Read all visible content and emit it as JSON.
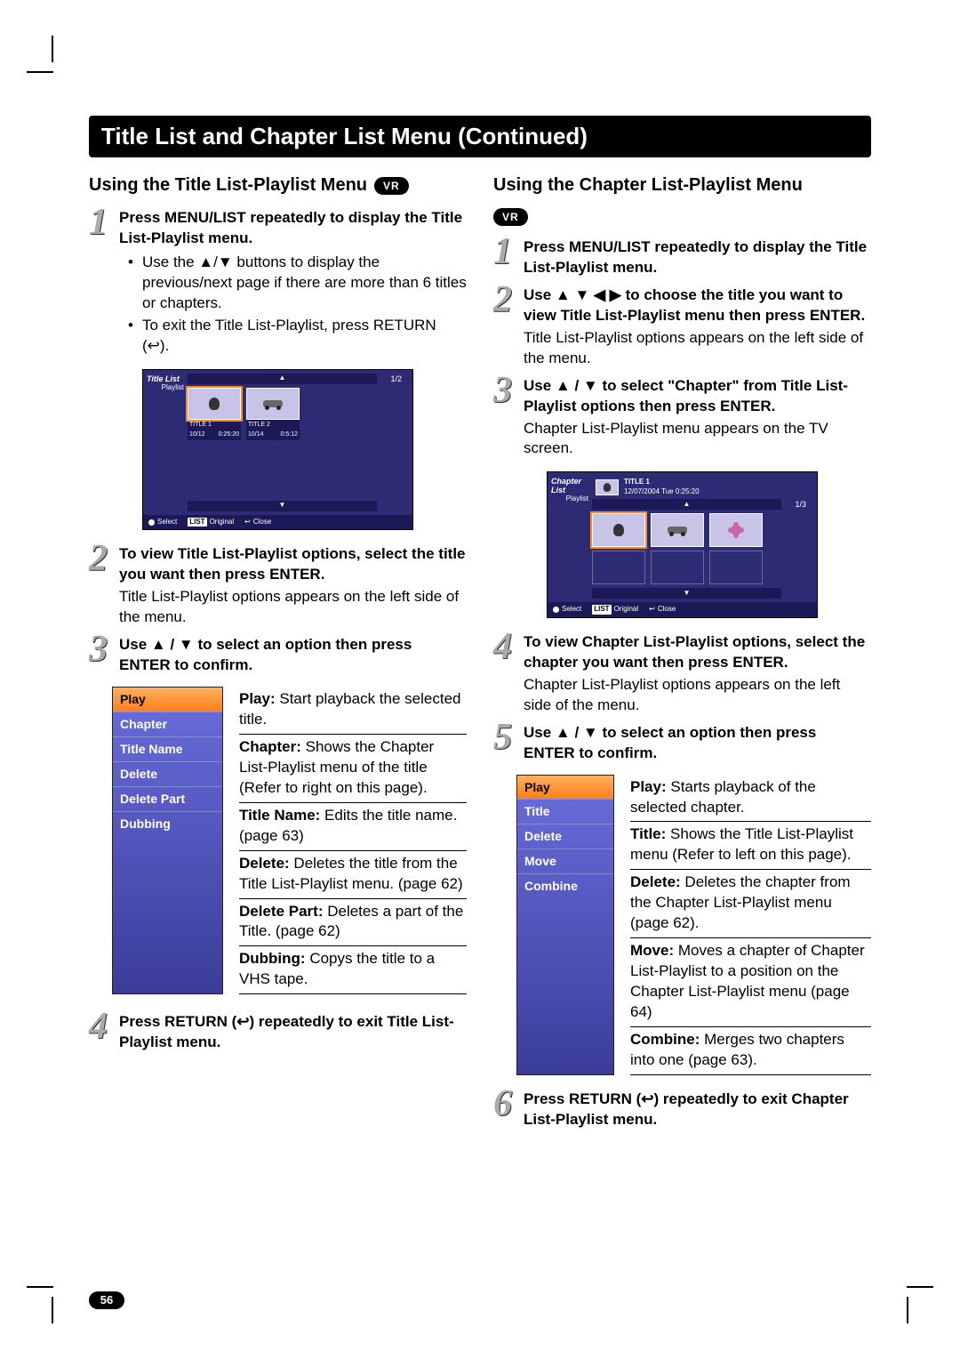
{
  "page": {
    "title": "Title List and Chapter List Menu (Continued)",
    "number": "56"
  },
  "badges": {
    "vr": "VR"
  },
  "left": {
    "heading": "Using the Title List-Playlist Menu",
    "step1": {
      "bold": "Press MENU/LIST repeatedly to display the Title List-Playlist menu.",
      "b1": "Use the ▲/▼ buttons to display the previous/next page if there are more than 6 titles or chapters.",
      "b2": "To exit the Title List-Playlist, press RETURN (↩)."
    },
    "fig": {
      "side_title": "Title List",
      "side_sub": "Playlist",
      "page_ind": "1/2",
      "t1_name": "TITLE 1",
      "t1_date": "10/12",
      "t1_len": "0:25:20",
      "t2_name": "TITLE 2",
      "t2_date": "10/14",
      "t2_len": "0:5:12",
      "bb_select": "Select",
      "bb_list": "LIST",
      "bb_orig": "Original",
      "bb_close": "Close"
    },
    "step2": {
      "bold": "To view Title List-Playlist options, select the title you want then press ENTER.",
      "text": "Title List-Playlist options appears on the left side of the menu."
    },
    "step3": {
      "bold": "Use ▲ / ▼ to select an option then press ENTER to confirm."
    },
    "options": [
      "Play",
      "Chapter",
      "Title Name",
      "Delete",
      "Delete Part",
      "Dubbing"
    ],
    "desc": {
      "play_k": "Play:",
      "play_v": " Start playback the selected title.",
      "chap_k": "Chapter:",
      "chap_v": " Shows the Chapter List-Playlist menu of the title (Refer to right on this page).",
      "tn_k": "Title Name:",
      "tn_v": " Edits the title name. (page 63)",
      "del_k": "Delete:",
      "del_v": " Deletes the title from the Title List-Playlist  menu. (page 62)",
      "dp_k": "Delete Part:",
      "dp_v": " Deletes a part of the Title. (page 62)",
      "dub_k": "Dubbing:",
      "dub_v": " Copys the title to a VHS tape."
    },
    "step4": {
      "bold": "Press RETURN (↩) repeatedly to exit Title List-Playlist menu."
    }
  },
  "right": {
    "heading": "Using the Chapter List-Playlist Menu",
    "step1": {
      "bold": "Press MENU/LIST repeatedly to display the Title List-Playlist menu."
    },
    "step2": {
      "bold": "Use ▲ ▼ ◀ ▶ to choose the title you want to view Title List-Playlist menu then press ENTER.",
      "text": "Title List-Playlist options appears on the left side of the menu."
    },
    "step3": {
      "bold": "Use ▲ / ▼ to select \"Chapter\" from Title List-Playlist options then press ENTER.",
      "text": "Chapter List-Playlist menu appears on the TV screen."
    },
    "fig": {
      "side_title": "Chapter List",
      "side_sub": "Playlist",
      "meta_title": "TITLE 1",
      "meta_sub": "12/07/2004  Tue 0:25:20",
      "page_ind": "1/3",
      "bb_select": "Select",
      "bb_list": "LIST",
      "bb_orig": "Original",
      "bb_close": "Close"
    },
    "step4": {
      "bold": "To view Chapter List-Playlist options, select the chapter you want then press ENTER.",
      "text": "Chapter List-Playlist options appears on the left side of the menu."
    },
    "step5": {
      "bold": "Use ▲ / ▼ to select an option then press ENTER to confirm."
    },
    "options": [
      "Play",
      "Title",
      "Delete",
      "Move",
      "Combine"
    ],
    "desc": {
      "play_k": "Play:",
      "play_v": " Starts playback of the selected chapter.",
      "tit_k": "Title:",
      "tit_v": " Shows the Title List-Playlist menu (Refer to left on this page).",
      "del_k": "Delete:",
      "del_v": " Deletes the chapter from the Chapter List-Playlist menu (page 62).",
      "mov_k": "Move:",
      "mov_v": " Moves a chapter of Chapter List-Playlist to a position on the Chapter List-Playlist menu (page 64)",
      "com_k": "Combine:",
      "com_v": " Merges two chapters into one (page 63)."
    },
    "step6": {
      "bold": "Press RETURN (↩) repeatedly to exit Chapter List-Playlist menu."
    }
  }
}
